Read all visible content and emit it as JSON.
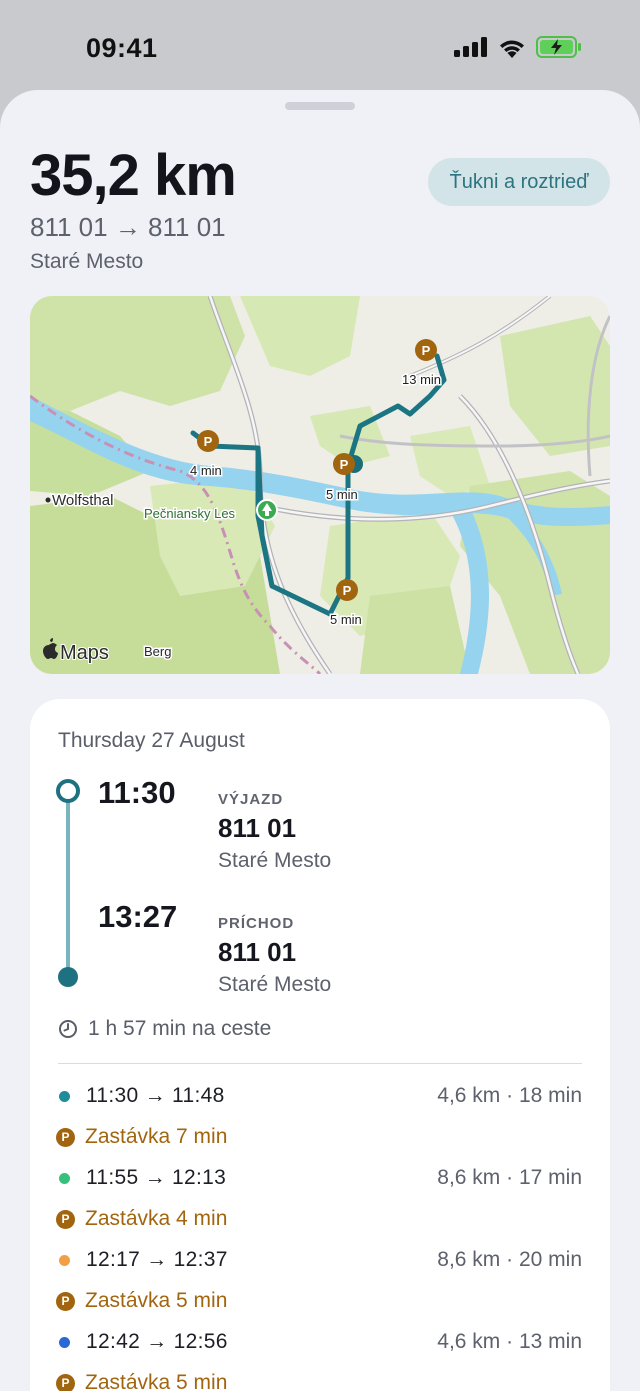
{
  "status_bar": {
    "time": "09:41",
    "icons": [
      "cellular-signal-icon",
      "wifi-icon",
      "battery-charging-icon"
    ]
  },
  "header": {
    "distance": "35,2 km",
    "route_codes": "811 01 → 811 01",
    "place": "Staré Mesto",
    "sort_button": "Ťukni a roztrieď"
  },
  "map": {
    "labels": {
      "wolfsthal": "Wolfsthal",
      "forest": "Pečniansky Les",
      "berg": "Berg",
      "maps_logo": "Maps"
    },
    "stops": [
      {
        "label": "13 min"
      },
      {
        "label": "4 min"
      },
      {
        "label": "5 min"
      },
      {
        "label": "5 min"
      }
    ],
    "parking_symbol": "P"
  },
  "card": {
    "date": "Thursday 27 August",
    "departure": {
      "time": "11:30",
      "tag": "VÝJAZD",
      "code": "811 01",
      "place": "Staré Mesto"
    },
    "arrival": {
      "time": "13:27",
      "tag": "PRÍCHOD",
      "code": "811 01",
      "place": "Staré Mesto"
    },
    "duration": "1 h 57 min na ceste",
    "legs": [
      {
        "time": "11:30 → 11:48",
        "stats": "4,6 km · 18 min",
        "color": "#1e8c9a"
      },
      {
        "time": "11:55 → 12:13",
        "stats": "8,6 km · 17 min",
        "color": "#35c07c"
      },
      {
        "time": "12:17 → 12:37",
        "stats": "8,6 km · 20 min",
        "color": "#f2a043"
      },
      {
        "time": "12:42 → 12:56",
        "stats": "4,6 km · 13 min",
        "color": "#2a68d6"
      }
    ],
    "stops": [
      {
        "label": "Zastávka 7 min"
      },
      {
        "label": "Zastávka 4 min"
      },
      {
        "label": "Zastávka 5 min"
      },
      {
        "label": "Zastávka 5 min"
      }
    ],
    "colors": {
      "accent": "#1e7180",
      "stop": "#a2650f"
    }
  }
}
